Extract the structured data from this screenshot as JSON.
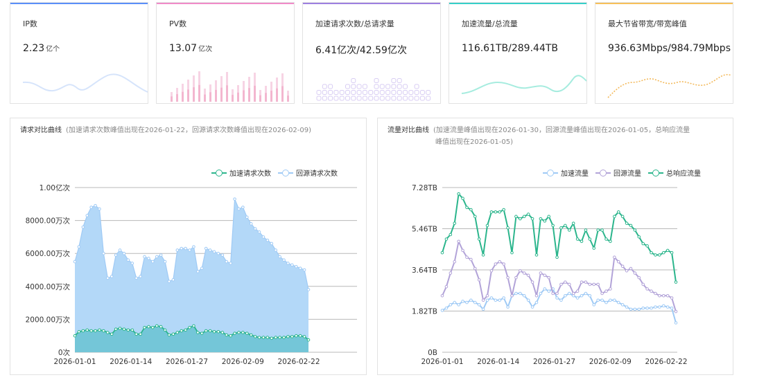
{
  "stats": [
    {
      "label": "IP数",
      "value": "2.23",
      "unit": "亿个",
      "color": "#5b8ff9"
    },
    {
      "label": "PV数",
      "value": "13.07",
      "unit": "亿次",
      "color": "#f08bc9"
    },
    {
      "label": "加速请求次数/总请求量",
      "value": "6.41亿次/42.59亿次",
      "unit": "",
      "color": "#9d80e0"
    },
    {
      "label": "加速流量/总流量",
      "value": "116.61TB/289.44TB",
      "unit": "",
      "color": "#36cfc9"
    },
    {
      "label": "最大节省带宽/带宽峰值",
      "value": "936.63Mbps/984.79Mbps",
      "unit": "",
      "color": "#f7c05a"
    }
  ],
  "requests_panel": {
    "title": "请求对比曲线",
    "subtitle": "(加速请求次数峰值出现在2026-01-22，回源请求次数峰值出现在2026-02-09)",
    "legend": [
      "加速请求次数",
      "回源请求次数"
    ]
  },
  "traffic_panel": {
    "title": "流量对比曲线",
    "subtitle_line1": "(加速流量峰值出现在2026-01-30，回源流量峰值出现在2026-01-05，总响应流量",
    "subtitle_line2": "峰值出现在2026-01-05)",
    "legend": [
      "加速流量",
      "回源流量",
      "总响应流量"
    ]
  },
  "chart_data": [
    {
      "type": "area",
      "title": "请求对比曲线",
      "x_ticks": [
        "2026-01-01",
        "2026-01-14",
        "2026-01-27",
        "2026-02-09",
        "2026-02-22"
      ],
      "y_ticks": [
        "0次",
        "2000.00万次",
        "4000.00万次",
        "6000.00万次",
        "8000.00万次",
        "1.00亿次"
      ],
      "ylim": [
        0,
        10000
      ],
      "series": [
        {
          "name": "回源请求次数",
          "color": "#9fcaf5",
          "values": [
            5500,
            6400,
            7600,
            8300,
            8800,
            8900,
            8700,
            6000,
            4500,
            4600,
            5900,
            6200,
            6000,
            5600,
            5400,
            4500,
            4600,
            5800,
            5700,
            5500,
            5800,
            5900,
            5500,
            4300,
            4400,
            6200,
            6300,
            6300,
            6200,
            6400,
            4900,
            5100,
            6300,
            6200,
            6100,
            6000,
            5900,
            5500,
            5400,
            9300,
            8700,
            8800,
            8200,
            7800,
            7500,
            7300,
            7000,
            6800,
            6600,
            6200,
            5800,
            5600,
            5400,
            5300,
            5200,
            5100,
            5000,
            3800
          ]
        },
        {
          "name": "加速请求次数",
          "color": "#2bb58c",
          "values": [
            1000,
            1250,
            1300,
            1350,
            1300,
            1300,
            1350,
            1300,
            1200,
            1100,
            1400,
            1450,
            1400,
            1350,
            1350,
            1100,
            1100,
            1500,
            1550,
            1500,
            1600,
            1550,
            1350,
            1050,
            1100,
            1200,
            1300,
            1350,
            1500,
            1600,
            1200,
            1150,
            1300,
            1300,
            1250,
            1250,
            1200,
            1050,
            1000,
            1150,
            1200,
            1200,
            1150,
            1050,
            950,
            900,
            900,
            900,
            850,
            900,
            900,
            900,
            950,
            950,
            1000,
            1000,
            950,
            750
          ]
        }
      ]
    },
    {
      "type": "line",
      "title": "流量对比曲线",
      "x_ticks": [
        "2026-01-01",
        "2026-01-14",
        "2026-01-27",
        "2026-02-09",
        "2026-02-22"
      ],
      "y_ticks": [
        "0B",
        "1.82TB",
        "3.64TB",
        "5.46TB",
        "7.28TB"
      ],
      "ylim": [
        0,
        7.28
      ],
      "series": [
        {
          "name": "加速流量",
          "color": "#9fcaf5",
          "values": [
            1.85,
            1.95,
            2.1,
            2.2,
            2.1,
            2.25,
            2.2,
            2.3,
            2.2,
            2.1,
            1.9,
            2.3,
            2.4,
            2.3,
            2.3,
            2.4,
            2.0,
            2.5,
            2.6,
            2.6,
            2.5,
            2.3,
            2.0,
            2.2,
            2.6,
            2.8,
            2.7,
            2.8,
            2.4,
            2.3,
            2.5,
            2.6,
            2.5,
            2.4,
            2.5,
            2.6,
            2.5,
            2.1,
            2.3,
            2.3,
            2.2,
            2.3,
            2.3,
            2.2,
            2.1,
            2.0,
            1.9,
            1.9,
            1.9,
            1.95,
            1.95,
            1.95,
            2.0,
            2.0,
            2.05,
            2.0,
            1.95,
            1.3
          ]
        },
        {
          "name": "回源流量",
          "color": "#b2a3d8",
          "values": [
            2.5,
            2.9,
            3.5,
            4.0,
            4.9,
            4.5,
            4.2,
            4.1,
            3.7,
            3.2,
            2.3,
            2.5,
            3.6,
            3.9,
            4.0,
            3.9,
            3.3,
            2.5,
            3.3,
            3.6,
            3.5,
            3.4,
            3.1,
            2.5,
            3.5,
            3.4,
            3.3,
            2.6,
            2.6,
            3.0,
            3.1,
            3.0,
            2.6,
            2.7,
            3.1,
            3.1,
            3.0,
            3.0,
            3.0,
            2.6,
            2.7,
            2.8,
            4.2,
            4.0,
            3.8,
            3.6,
            3.7,
            3.5,
            3.3,
            3.0,
            2.8,
            2.7,
            2.6,
            2.5,
            2.5,
            2.5,
            2.4,
            1.8
          ]
        },
        {
          "name": "总响应流量",
          "color": "#2bb58c",
          "values": [
            4.4,
            5.0,
            5.2,
            5.7,
            7.0,
            6.8,
            6.4,
            6.3,
            6.0,
            5.0,
            4.3,
            5.6,
            6.2,
            6.2,
            6.2,
            6.3,
            5.5,
            4.4,
            6.0,
            5.9,
            6.0,
            6.1,
            5.9,
            4.3,
            5.9,
            5.8,
            6.0,
            5.6,
            4.2,
            5.5,
            5.6,
            5.4,
            5.7,
            5.0,
            4.9,
            5.4,
            5.0,
            4.6,
            5.4,
            5.4,
            5.0,
            4.9,
            6.0,
            6.2,
            6.0,
            5.7,
            5.6,
            5.4,
            5.1,
            4.8,
            4.7,
            4.4,
            4.3,
            4.3,
            4.4,
            4.5,
            4.4,
            3.1
          ]
        }
      ]
    }
  ]
}
